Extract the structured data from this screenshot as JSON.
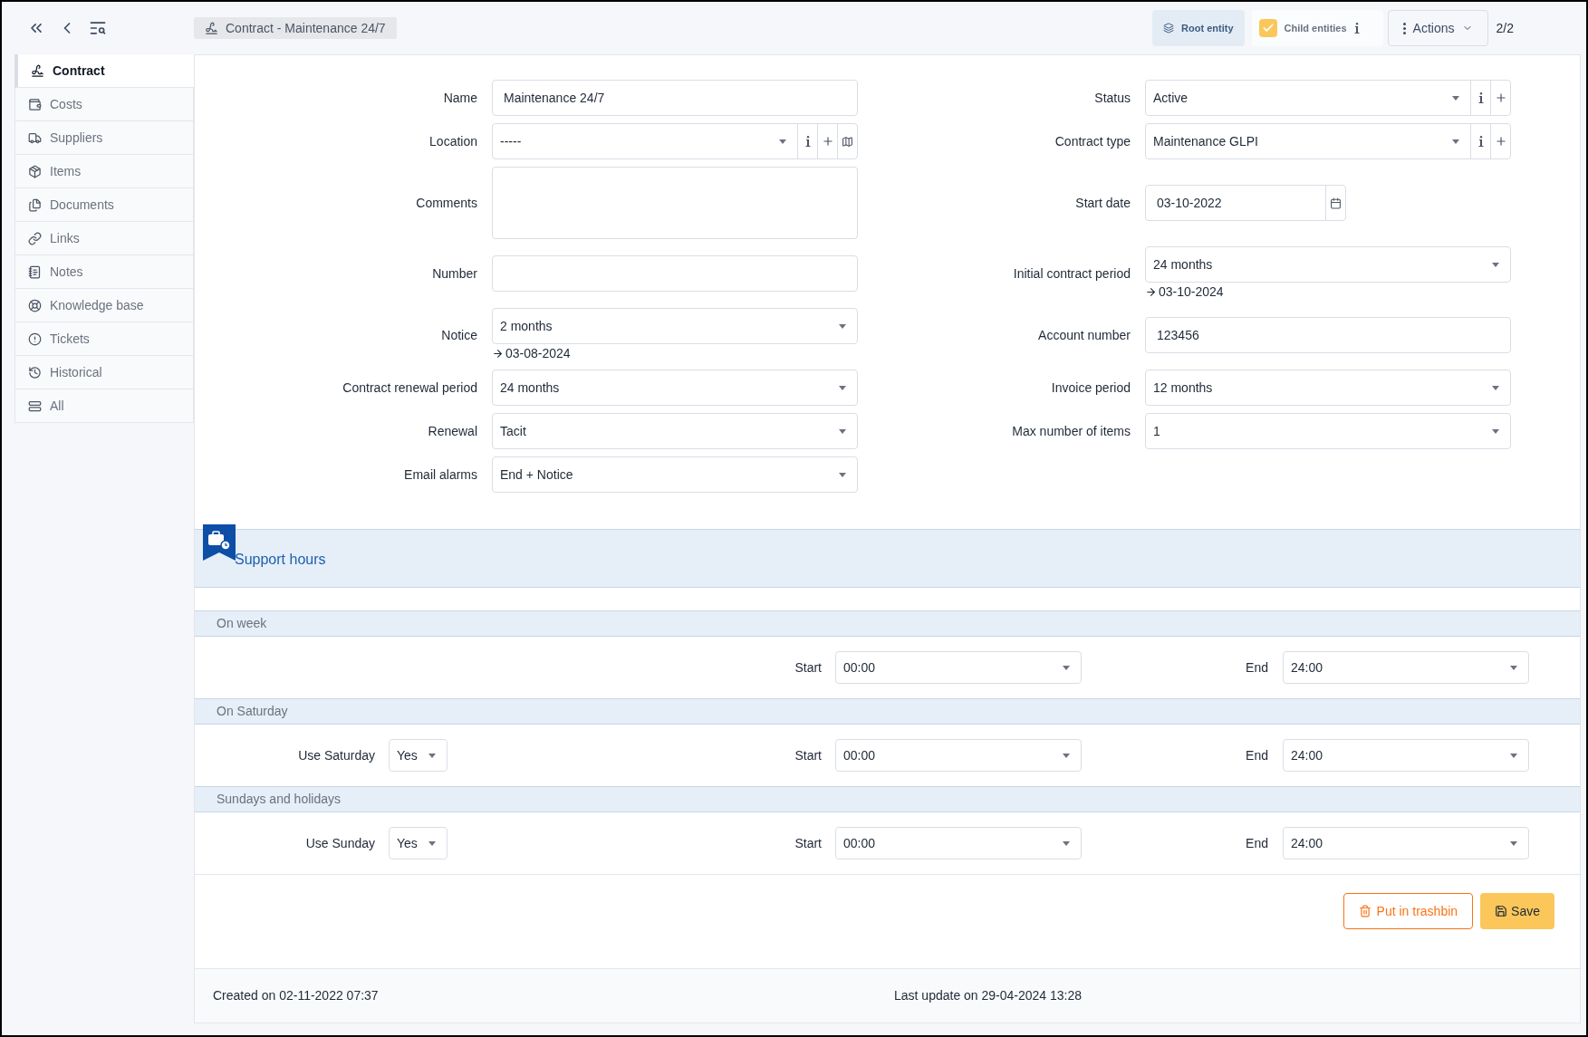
{
  "header": {
    "breadcrumb": "Contract -  Maintenance 24/7",
    "root_entity": "Root entity",
    "child_entities": {
      "label": "Child entities",
      "checked": true
    },
    "actions": "Actions",
    "pager": "2/2"
  },
  "sidebar": {
    "items": [
      {
        "label": "Contract",
        "selected": true
      },
      {
        "label": "Costs",
        "selected": false
      },
      {
        "label": "Suppliers",
        "selected": false
      },
      {
        "label": "Items",
        "selected": false
      },
      {
        "label": "Documents",
        "selected": false
      },
      {
        "label": "Links",
        "selected": false
      },
      {
        "label": "Notes",
        "selected": false
      },
      {
        "label": "Knowledge base",
        "selected": false
      },
      {
        "label": "Tickets",
        "selected": false
      },
      {
        "label": "Historical",
        "selected": false
      },
      {
        "label": "All",
        "selected": false
      }
    ]
  },
  "form": {
    "rows": [
      {
        "left": {
          "label": "Name",
          "kind": "text",
          "value": "Maintenance 24/7"
        },
        "right": {
          "label": "Status",
          "kind": "select",
          "value": "Active",
          "actions": [
            {
              "kind": "info"
            },
            {
              "kind": "add"
            }
          ]
        }
      },
      {
        "left": {
          "label": "Location",
          "kind": "select",
          "value": "-----",
          "actions": [
            {
              "kind": "info"
            },
            {
              "kind": "add"
            },
            {
              "kind": "map"
            }
          ]
        },
        "right": {
          "label": "Contract type",
          "kind": "select",
          "value": "Maintenance GLPI",
          "actions": [
            {
              "kind": "info"
            },
            {
              "kind": "add"
            }
          ]
        }
      },
      {
        "left": {
          "label": "Comments",
          "kind": "textarea"
        },
        "right": {
          "label": "Start date",
          "kind": "date",
          "value": "03-10-2022"
        }
      },
      {
        "left": {
          "label": "Number",
          "kind": "text"
        },
        "right": {
          "label": "Initial contract period",
          "kind": "select",
          "value": "24 months",
          "due": "03-10-2024"
        }
      },
      {
        "left": {
          "label": "Notice",
          "kind": "select",
          "value": "2 months",
          "due": "03-08-2024"
        },
        "right": {
          "label": "Account number",
          "kind": "text",
          "value": "123456"
        }
      },
      {
        "left": {
          "label": "Contract renewal period",
          "kind": "select",
          "value": "24 months"
        },
        "right": {
          "label": "Invoice period",
          "kind": "select",
          "value": "12 months"
        }
      },
      {
        "left": {
          "label": "Renewal",
          "kind": "select",
          "value": "Tacit"
        },
        "right": {
          "label": "Max number of items",
          "kind": "select",
          "value": "1"
        }
      },
      {
        "left": {
          "label": "Email alarms",
          "kind": "select",
          "value": "End + Notice"
        }
      }
    ]
  },
  "support_hours": {
    "title": "Support hours",
    "sections": [
      {
        "title": "On week",
        "start": {
          "label": "Start",
          "value": "00:00"
        },
        "end": {
          "label": "End",
          "value": "24:00"
        }
      },
      {
        "title": "On Saturday",
        "toggle": {
          "label": "Use Saturday",
          "value": "Yes"
        },
        "start": {
          "label": "Start",
          "value": "00:00"
        },
        "end": {
          "label": "End",
          "value": "24:00"
        }
      },
      {
        "title": "Sundays and holidays",
        "toggle": {
          "label": "Use Sunday",
          "value": "Yes"
        },
        "start": {
          "label": "Start",
          "value": "00:00"
        },
        "end": {
          "label": "End",
          "value": "24:00"
        }
      }
    ]
  },
  "buttons": {
    "trash": "Put in trashbin",
    "save": "Save"
  },
  "footer": {
    "created": "Created on 02-11-2022 07:37",
    "updated": "Last update on 29-04-2024 13:28"
  }
}
